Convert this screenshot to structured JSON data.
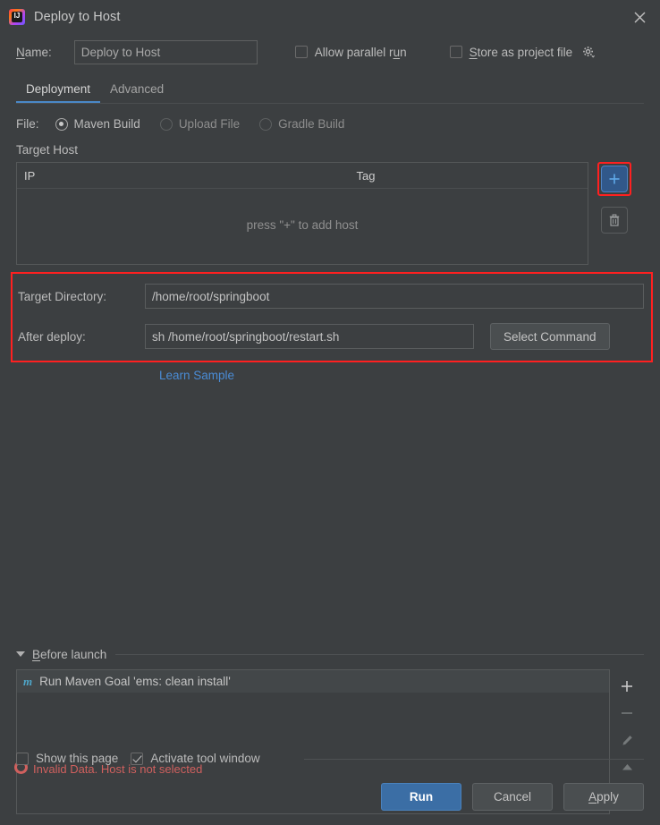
{
  "window": {
    "title": "Deploy to Host",
    "app_icon": "intellij-idea-icon",
    "close_icon": "close-icon"
  },
  "name_row": {
    "label_prefix": "N",
    "label_rest": "ame:",
    "value": "Deploy to Host",
    "allow_parallel": {
      "label_a": "Allow parallel r",
      "label_mn": "u",
      "label_b": "n",
      "checked": false
    },
    "store_project_file": {
      "label_mn": "S",
      "label_rest": "tore as project file",
      "checked": false
    },
    "gear_icon": "gear-icon"
  },
  "tabs": [
    {
      "label": "Deployment",
      "active": true
    },
    {
      "label": "Advanced",
      "active": false
    }
  ],
  "file_row": {
    "label": "File:",
    "options": [
      {
        "label": "Maven Build",
        "selected": true,
        "enabled": true
      },
      {
        "label": "Upload File",
        "selected": false,
        "enabled": false
      },
      {
        "label": "Gradle Build",
        "selected": false,
        "enabled": false
      }
    ]
  },
  "target_host": {
    "section_label": "Target Host",
    "columns": [
      "IP",
      "Tag"
    ],
    "rows": [],
    "empty_text": "press \"+\" to add host",
    "add_icon": "plus-icon",
    "delete_icon": "trash-icon"
  },
  "deploy_fields": {
    "target_directory": {
      "label": "Target Directory:",
      "value": "/home/root/springboot"
    },
    "after_deploy": {
      "label": "After deploy:",
      "value": "sh /home/root/springboot/restart.sh"
    },
    "select_command_label": "Select Command",
    "learn_sample_label": "Learn Sample"
  },
  "before_launch": {
    "title_mn": "B",
    "title_rest": "efore launch",
    "collapse_icon": "triangle-down-icon",
    "items": [
      {
        "icon": "maven-icon",
        "icon_glyph": "m",
        "label": "Run Maven Goal 'ems: clean install'"
      }
    ],
    "tools": [
      {
        "name": "add-before-launch-task",
        "glyph": "+",
        "enabled": true
      },
      {
        "name": "remove-before-launch-task",
        "glyph": "−",
        "enabled": false
      },
      {
        "name": "edit-before-launch-task",
        "glyph": "✎",
        "enabled": false
      },
      {
        "name": "move-up-before-launch-task",
        "glyph": "▲",
        "enabled": false
      },
      {
        "name": "move-down-before-launch-task",
        "glyph": "▼",
        "enabled": false
      }
    ]
  },
  "footer": {
    "show_this_page": {
      "label": "Show this page",
      "checked": false
    },
    "activate_tool_window": {
      "label": "Activate tool window",
      "checked": true
    },
    "error_text": "Invalid Data. Host is not selected",
    "error_icon": "error-icon",
    "buttons": [
      {
        "label": "Run",
        "primary": true
      },
      {
        "label": "Cancel",
        "primary": false
      },
      {
        "label": "Apply",
        "primary": false,
        "mnemonic": "A"
      }
    ]
  },
  "colors": {
    "accent_blue": "#4a88c7",
    "link_blue": "#4a8bd4",
    "annotation_red": "#ff2020",
    "error_red": "#d0605e",
    "background": "#3c3f41"
  }
}
